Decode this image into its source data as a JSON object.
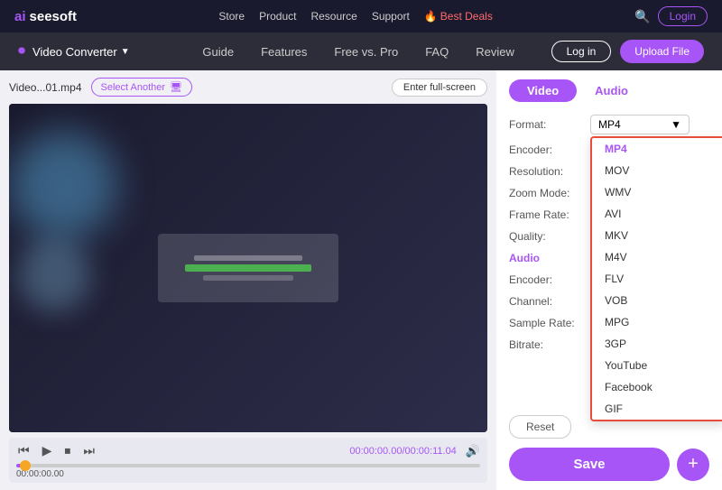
{
  "topNav": {
    "logo_ai": "ai",
    "logo_rest": "seesoft",
    "links": [
      "Store",
      "Product",
      "Resource",
      "Support",
      "Best Deals"
    ],
    "search_label": "🔍",
    "login_label": "Login"
  },
  "secNav": {
    "icon": "⏺",
    "converter_label": "Video Converter",
    "chevron": "▼",
    "links": [
      "Guide",
      "Features",
      "Free vs. Pro",
      "FAQ",
      "Review"
    ],
    "login_label": "Log in",
    "upload_label": "Upload File"
  },
  "fileBar": {
    "filename": "Video...01.mp4",
    "select_another": "Select Another",
    "fullscreen": "Enter full-screen"
  },
  "controls": {
    "time_display": "00:00:00.00/00:00:11.04",
    "current_time": "00:00:00.00"
  },
  "tabs": {
    "video": "Video",
    "audio": "Audio"
  },
  "settings": {
    "format_label": "Format:",
    "format_value": "MP4",
    "encoder_label": "Encoder:",
    "resolution_label": "Resolution:",
    "zoom_label": "Zoom Mode:",
    "framerate_label": "Frame Rate:",
    "quality_label": "Quality:",
    "audio_label": "Audio",
    "audio_encoder_label": "Encoder:",
    "channel_label": "Channel:",
    "samplerate_label": "Sample Rate:",
    "bitrate_label": "Bitrate:"
  },
  "dropdown": {
    "items": [
      "MP4",
      "MOV",
      "WMV",
      "AVI",
      "MKV",
      "M4V",
      "FLV",
      "VOB",
      "MPG",
      "3GP",
      "YouTube",
      "Facebook",
      "GIF"
    ],
    "selected": "MP4"
  },
  "buttons": {
    "reset": "Reset",
    "save": "Save",
    "plus": "+"
  },
  "colors": {
    "accent": "#a855f7",
    "danger": "#e74c3c",
    "text_muted": "#555555"
  }
}
